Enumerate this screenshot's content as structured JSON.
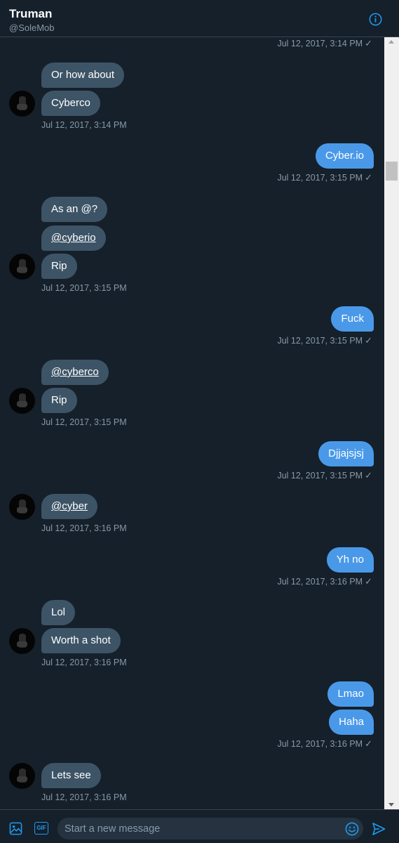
{
  "header": {
    "name": "Truman",
    "handle": "@SoleMob"
  },
  "messages": {
    "ts0": "Jul 12, 2017, 3:14 PM",
    "m1": "Or how about",
    "m2": "Cyberco",
    "ts1": "Jul 12, 2017, 3:14 PM",
    "m3": "Cyber.io",
    "ts2": "Jul 12, 2017, 3:15 PM",
    "m4": "As an @?",
    "m5": "@cyberio",
    "m6": "Rip",
    "ts3": "Jul 12, 2017, 3:15 PM",
    "m7": "Fuck",
    "ts4": "Jul 12, 2017, 3:15 PM",
    "m8": "@cyberco",
    "m9": "Rip",
    "ts5": "Jul 12, 2017, 3:15 PM",
    "m10": "Djjajsjsj",
    "ts6": "Jul 12, 2017, 3:15 PM",
    "m11": "@cyber",
    "ts7": "Jul 12, 2017, 3:16 PM",
    "m12": "Yh no",
    "ts8": "Jul 12, 2017, 3:16 PM",
    "m13": "Lol",
    "m14": "Worth a shot",
    "ts9": "Jul 12, 2017, 3:16 PM",
    "m15": "Lmao",
    "m16": "Haha",
    "ts10": "Jul 12, 2017, 3:16 PM",
    "m17": "Lets see",
    "ts11": "Jul 12, 2017, 3:16 PM",
    "check": "✓"
  },
  "composer": {
    "placeholder": "Start a new message",
    "gif_label": "GIF"
  },
  "icons": {
    "info": "info-icon",
    "image": "image-icon",
    "gif": "gif-icon",
    "emoji": "emoji-icon",
    "send": "send-icon"
  },
  "colors": {
    "background": "#15202b",
    "incoming_bubble": "#3d5466",
    "outgoing_bubble": "#4a99e9",
    "accent": "#1d9bf0",
    "muted_text": "#8899a6"
  }
}
